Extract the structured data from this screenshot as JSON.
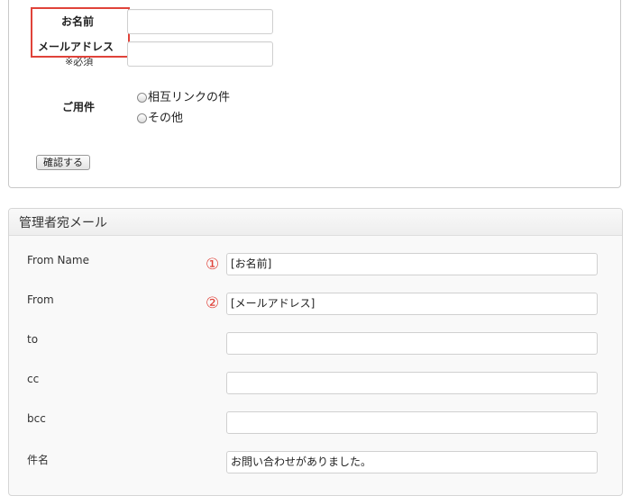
{
  "form_preview": {
    "name_label": "お名前",
    "email_label": "メールアドレス",
    "required_note": "※必須",
    "inquiry_label": "ご用件",
    "radio_options": [
      "相互リンクの件",
      "その他"
    ],
    "confirm_button": "確認する"
  },
  "admin_mail": {
    "title": "管理者宛メール",
    "fields": [
      {
        "label": "From Name",
        "value": "[お名前]",
        "marker": "①"
      },
      {
        "label": "From",
        "value": "[メールアドレス]",
        "marker": "②"
      },
      {
        "label": "to",
        "value": ""
      },
      {
        "label": "cc",
        "value": ""
      },
      {
        "label": "bcc",
        "value": ""
      },
      {
        "label": "件名",
        "value": "お問い合わせがありました。"
      }
    ]
  },
  "colors": {
    "highlight_red": "#e0433a"
  }
}
